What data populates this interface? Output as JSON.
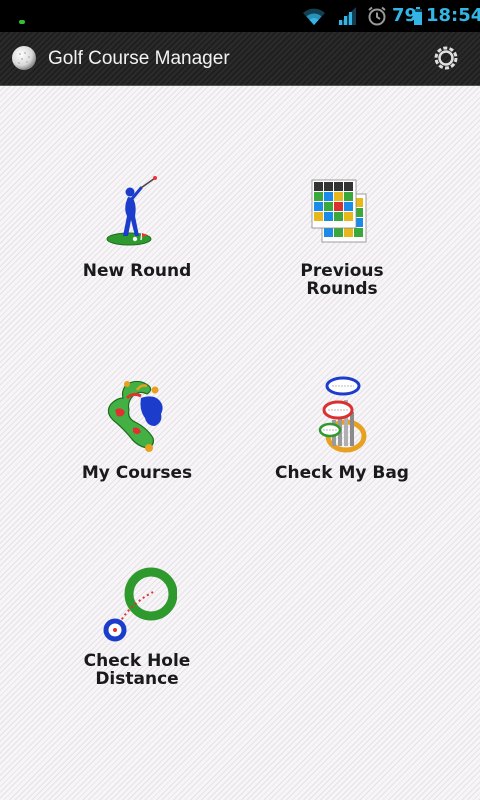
{
  "status_bar": {
    "battery_level": "79",
    "time": "18:54",
    "accent_color": "#33b5e5"
  },
  "app_bar": {
    "title": "Golf Course Manager",
    "logo_icon": "golf-ball-icon",
    "settings_icon": "settings-icon"
  },
  "menu": {
    "new_round": "New Round",
    "previous_rounds": "Previous\nRounds",
    "my_courses": "My Courses",
    "check_my_bag": "Check My Bag",
    "check_hole_distance": "Check Hole\nDistance"
  }
}
